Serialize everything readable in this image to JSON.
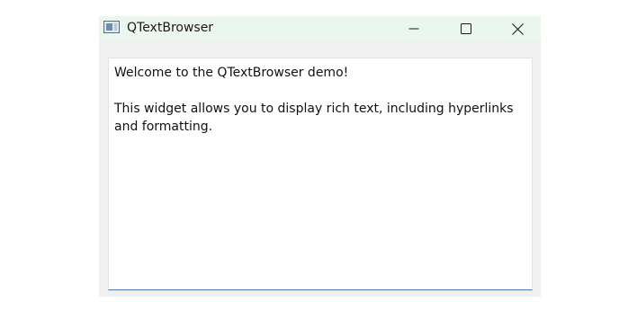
{
  "window": {
    "title": "QTextBrowser",
    "app_icon": "window-app-icon",
    "controls": {
      "minimize_icon": "minimize-icon",
      "maximize_icon": "maximize-icon",
      "close_icon": "close-icon"
    }
  },
  "browser": {
    "paragraphs": [
      "Welcome to the QTextBrowser demo!",
      "This widget allows you to display rich text, including hyperlinks and formatting."
    ]
  },
  "colors": {
    "titlebar_bg": "#eaf6ee",
    "window_bg": "#f0f0f0",
    "focus_underline": "#4a79a8"
  }
}
